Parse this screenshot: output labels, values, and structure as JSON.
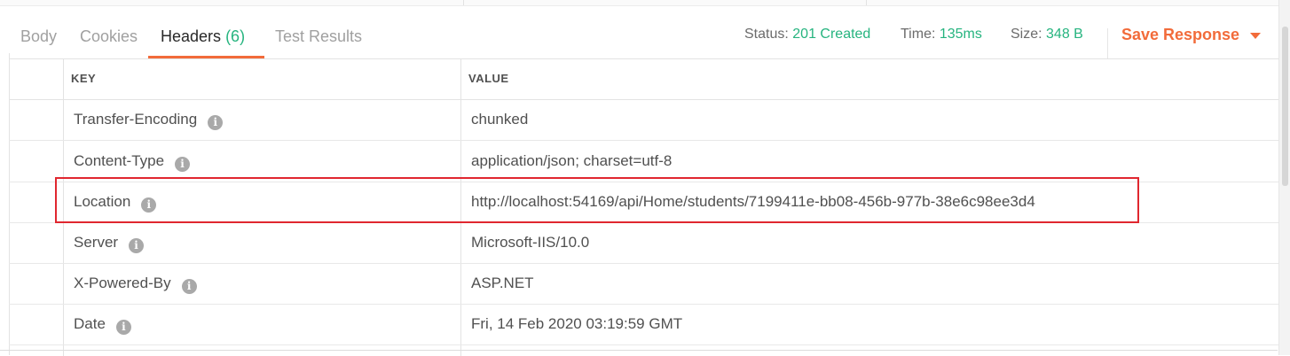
{
  "tabs": [
    {
      "label": "Body"
    },
    {
      "label": "Cookies"
    },
    {
      "label": "Headers",
      "count": "(6)"
    },
    {
      "label": "Test Results"
    }
  ],
  "status": {
    "label": "Status:",
    "value": "201 Created"
  },
  "time": {
    "label": "Time:",
    "value": "135ms"
  },
  "size": {
    "label": "Size:",
    "value": "348 B"
  },
  "save_response": "Save Response",
  "table": {
    "columns": {
      "key": "KEY",
      "value": "VALUE"
    },
    "rows": [
      {
        "key": "Transfer-Encoding",
        "value": "chunked"
      },
      {
        "key": "Content-Type",
        "value": "application/json; charset=utf-8"
      },
      {
        "key": "Location",
        "value": "http://localhost:54169/api/Home/students/7199411e-bb08-456b-977b-38e6c98ee3d4"
      },
      {
        "key": "Server",
        "value": "Microsoft-IIS/10.0"
      },
      {
        "key": "X-Powered-By",
        "value": "ASP.NET"
      },
      {
        "key": "Date",
        "value": "Fri, 14 Feb 2020 03:19:59 GMT"
      }
    ]
  },
  "colors": {
    "accent": "#f26b3a",
    "success": "#26b47f",
    "highlight": "#e0272f"
  },
  "icons": {
    "info": "info-icon",
    "dropdown": "caret-down-icon"
  }
}
